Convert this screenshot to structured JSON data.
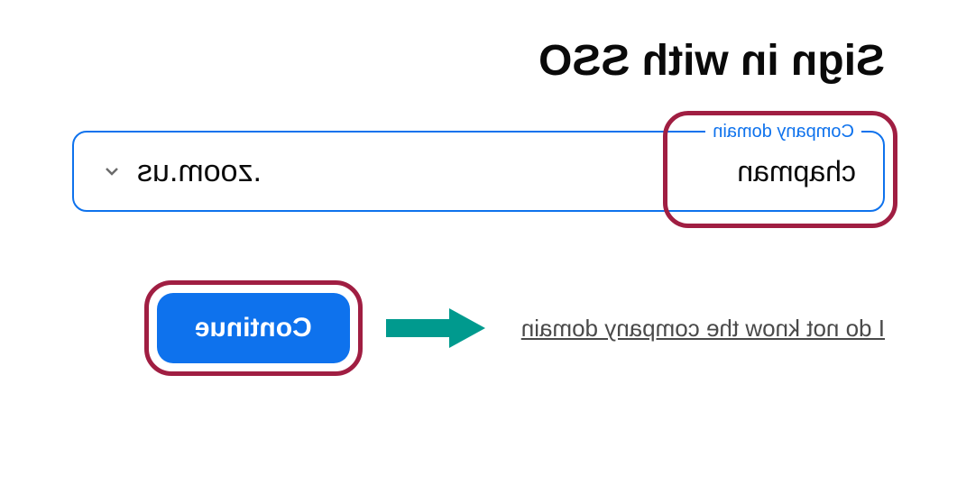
{
  "title": "Sign in with SSO",
  "input": {
    "label": "Company domain",
    "value": "chapman",
    "suffix": ".zoom.us"
  },
  "link_text": "I do not know the company domain",
  "button_label": "Continue",
  "colors": {
    "primary_blue": "#0e72ed",
    "highlight_maroon": "#a01e42",
    "arrow_teal": "#009a8e"
  }
}
